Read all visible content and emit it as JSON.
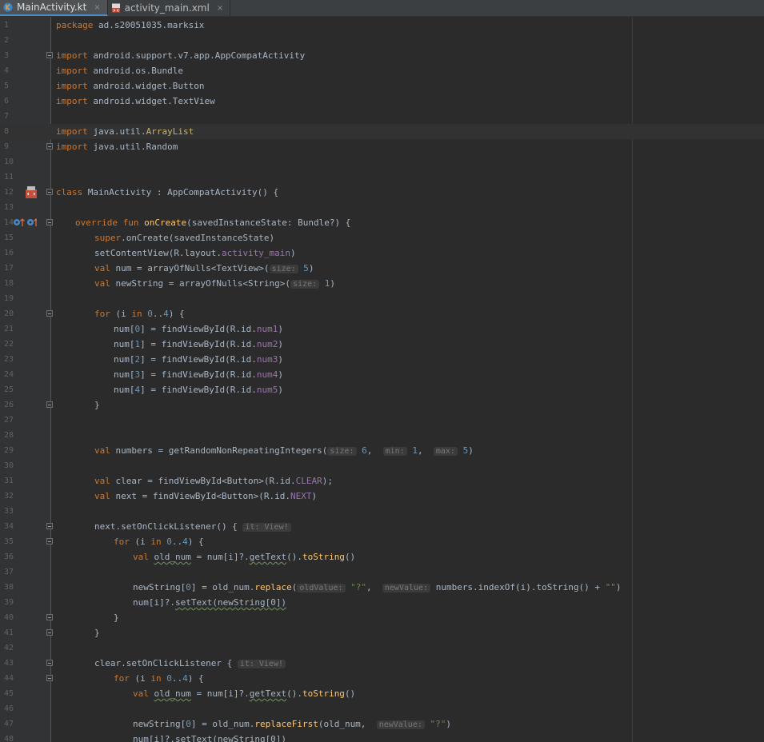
{
  "tabs": [
    {
      "label": "MainActivity.kt",
      "icon": "kotlin-file-icon",
      "active": true
    },
    {
      "label": "activity_main.xml",
      "icon": "xml-file-icon",
      "active": false
    }
  ],
  "tab_close_glyph": "×",
  "current_line": 8,
  "lines": [
    {
      "n": "1",
      "indent": 0,
      "tokens": [
        {
          "t": "package",
          "c": "kw"
        },
        {
          "t": " ad.s20051035.marksix"
        }
      ]
    },
    {
      "n": "2",
      "indent": 0,
      "tokens": []
    },
    {
      "n": "3",
      "indent": 0,
      "fold": true,
      "tokens": [
        {
          "t": "import",
          "c": "kw"
        },
        {
          "t": " android.support.v7.app.AppCompatActivity"
        }
      ]
    },
    {
      "n": "4",
      "indent": 0,
      "tokens": [
        {
          "t": "import",
          "c": "kw"
        },
        {
          "t": " android.os.Bundle"
        }
      ]
    },
    {
      "n": "5",
      "indent": 0,
      "tokens": [
        {
          "t": "import",
          "c": "kw"
        },
        {
          "t": " android.widget.Button"
        }
      ]
    },
    {
      "n": "6",
      "indent": 0,
      "tokens": [
        {
          "t": "import",
          "c": "kw"
        },
        {
          "t": " android.widget.TextView"
        }
      ]
    },
    {
      "n": "7",
      "indent": 0,
      "tokens": []
    },
    {
      "n": "8",
      "indent": 0,
      "tokens": [
        {
          "t": "import",
          "c": "kw"
        },
        {
          "t": " java.util."
        },
        {
          "t": "ArrayList",
          "c": "typ"
        }
      ]
    },
    {
      "n": "9",
      "indent": 0,
      "fold": true,
      "tokens": [
        {
          "t": "import",
          "c": "kw"
        },
        {
          "t": " java.util.Random"
        }
      ]
    },
    {
      "n": "10",
      "indent": 0,
      "tokens": []
    },
    {
      "n": "11",
      "indent": 0,
      "tokens": []
    },
    {
      "n": "12",
      "indent": 0,
      "fold": true,
      "gutter_icon": "android-layout-icon",
      "tokens": [
        {
          "t": "class",
          "c": "kw"
        },
        {
          "t": " MainActivity : AppCompatActivity() {"
        }
      ]
    },
    {
      "n": "13",
      "indent": 0,
      "tokens": []
    },
    {
      "n": "14",
      "indent": 1,
      "fold": true,
      "gutter_icon": "override-method-icon",
      "tokens": [
        {
          "t": "override fun ",
          "c": "kw"
        },
        {
          "t": "onCreate",
          "c": "fn"
        },
        {
          "t": "(savedInstanceState: Bundle?) {"
        }
      ]
    },
    {
      "n": "15",
      "indent": 2,
      "tokens": [
        {
          "t": "super",
          "c": "kw"
        },
        {
          "t": ".onCreate(savedInstanceState)"
        }
      ]
    },
    {
      "n": "16",
      "indent": 2,
      "tokens": [
        {
          "t": "setContentView(R.layout."
        },
        {
          "t": "activity_main",
          "c": "res"
        },
        {
          "t": ")"
        }
      ]
    },
    {
      "n": "17",
      "indent": 2,
      "tokens": [
        {
          "t": "val",
          "c": "kw"
        },
        {
          "t": " num = arrayOfNulls<TextView>("
        },
        {
          "t": "size:",
          "c": "hint"
        },
        {
          "t": " "
        },
        {
          "t": "5",
          "c": "num"
        },
        {
          "t": ")"
        }
      ]
    },
    {
      "n": "18",
      "indent": 2,
      "tokens": [
        {
          "t": "val",
          "c": "kw"
        },
        {
          "t": " newString = arrayOfNulls<String>("
        },
        {
          "t": "size:",
          "c": "hint"
        },
        {
          "t": " "
        },
        {
          "t": "1",
          "c": "num"
        },
        {
          "t": ")"
        }
      ]
    },
    {
      "n": "19",
      "indent": 0,
      "tokens": []
    },
    {
      "n": "20",
      "indent": 2,
      "fold": true,
      "tokens": [
        {
          "t": "for",
          "c": "kw"
        },
        {
          "t": " (i "
        },
        {
          "t": "in",
          "c": "kw"
        },
        {
          "t": " "
        },
        {
          "t": "0",
          "c": "num"
        },
        {
          "t": ".."
        },
        {
          "t": "4",
          "c": "num"
        },
        {
          "t": ") {"
        }
      ]
    },
    {
      "n": "21",
      "indent": 3,
      "tokens": [
        {
          "t": "num["
        },
        {
          "t": "0",
          "c": "num"
        },
        {
          "t": "] = findViewById(R.id."
        },
        {
          "t": "num1",
          "c": "res"
        },
        {
          "t": ")"
        }
      ]
    },
    {
      "n": "22",
      "indent": 3,
      "tokens": [
        {
          "t": "num["
        },
        {
          "t": "1",
          "c": "num"
        },
        {
          "t": "] = findViewById(R.id."
        },
        {
          "t": "num2",
          "c": "res"
        },
        {
          "t": ")"
        }
      ]
    },
    {
      "n": "23",
      "indent": 3,
      "tokens": [
        {
          "t": "num["
        },
        {
          "t": "2",
          "c": "num"
        },
        {
          "t": "] = findViewById(R.id."
        },
        {
          "t": "num3",
          "c": "res"
        },
        {
          "t": ")"
        }
      ]
    },
    {
      "n": "24",
      "indent": 3,
      "tokens": [
        {
          "t": "num["
        },
        {
          "t": "3",
          "c": "num"
        },
        {
          "t": "] = findViewById(R.id."
        },
        {
          "t": "num4",
          "c": "res"
        },
        {
          "t": ")"
        }
      ]
    },
    {
      "n": "25",
      "indent": 3,
      "tokens": [
        {
          "t": "num["
        },
        {
          "t": "4",
          "c": "num"
        },
        {
          "t": "] = findViewById(R.id."
        },
        {
          "t": "num5",
          "c": "res"
        },
        {
          "t": ")"
        }
      ]
    },
    {
      "n": "26",
      "indent": 2,
      "fold": true,
      "tokens": [
        {
          "t": "}"
        }
      ]
    },
    {
      "n": "27",
      "indent": 0,
      "tokens": []
    },
    {
      "n": "28",
      "indent": 0,
      "tokens": []
    },
    {
      "n": "29",
      "indent": 2,
      "tokens": [
        {
          "t": "val",
          "c": "kw"
        },
        {
          "t": " numbers = getRandomNonRepeatingIntegers("
        },
        {
          "t": "size:",
          "c": "hint"
        },
        {
          "t": " "
        },
        {
          "t": "6",
          "c": "num"
        },
        {
          "t": ",  "
        },
        {
          "t": "min:",
          "c": "hint"
        },
        {
          "t": " "
        },
        {
          "t": "1",
          "c": "num"
        },
        {
          "t": ",  "
        },
        {
          "t": "max:",
          "c": "hint"
        },
        {
          "t": " "
        },
        {
          "t": "5",
          "c": "num"
        },
        {
          "t": ")"
        }
      ]
    },
    {
      "n": "30",
      "indent": 0,
      "tokens": []
    },
    {
      "n": "31",
      "indent": 2,
      "tokens": [
        {
          "t": "val",
          "c": "kw"
        },
        {
          "t": " clear = findViewById<Button>(R.id."
        },
        {
          "t": "CLEAR",
          "c": "res"
        },
        {
          "t": ");"
        }
      ]
    },
    {
      "n": "32",
      "indent": 2,
      "tokens": [
        {
          "t": "val",
          "c": "kw"
        },
        {
          "t": " next = findViewById<Button>(R.id."
        },
        {
          "t": "NEXT",
          "c": "res"
        },
        {
          "t": ")"
        }
      ]
    },
    {
      "n": "33",
      "indent": 0,
      "tokens": []
    },
    {
      "n": "34",
      "indent": 2,
      "fold": true,
      "tokens": [
        {
          "t": "next.setOnClickListener() { "
        },
        {
          "t": "it: View!",
          "c": "hint"
        }
      ]
    },
    {
      "n": "35",
      "indent": 3,
      "fold": true,
      "tokens": [
        {
          "t": "for",
          "c": "kw"
        },
        {
          "t": " (i "
        },
        {
          "t": "in",
          "c": "kw"
        },
        {
          "t": " "
        },
        {
          "t": "0",
          "c": "num"
        },
        {
          "t": ".."
        },
        {
          "t": "4",
          "c": "num"
        },
        {
          "t": ") {"
        }
      ]
    },
    {
      "n": "36",
      "indent": 4,
      "tokens": [
        {
          "t": "val",
          "c": "kw"
        },
        {
          "t": " "
        },
        {
          "t": "old_num",
          "c": "wavy"
        },
        {
          "t": " = num[i]?."
        },
        {
          "t": "getText",
          "c": "wavy"
        },
        {
          "t": "()."
        },
        {
          "t": "toString",
          "c": "fn"
        },
        {
          "t": "()"
        }
      ]
    },
    {
      "n": "37",
      "indent": 0,
      "tokens": []
    },
    {
      "n": "38",
      "indent": 4,
      "tokens": [
        {
          "t": "newString["
        },
        {
          "t": "0",
          "c": "num"
        },
        {
          "t": "] = old_num."
        },
        {
          "t": "replace",
          "c": "fn"
        },
        {
          "t": "("
        },
        {
          "t": "oldValue:",
          "c": "hint"
        },
        {
          "t": " "
        },
        {
          "t": "\"?\"",
          "c": "str"
        },
        {
          "t": ",  "
        },
        {
          "t": "newValue:",
          "c": "hint"
        },
        {
          "t": " numbers.indexOf(i).toString() + "
        },
        {
          "t": "\"\"",
          "c": "str"
        },
        {
          "t": ")"
        }
      ]
    },
    {
      "n": "39",
      "indent": 4,
      "tokens": [
        {
          "t": "num[i]?."
        },
        {
          "t": "setText(newString[0])",
          "c": "wavy"
        }
      ]
    },
    {
      "n": "40",
      "indent": 3,
      "fold": true,
      "tokens": [
        {
          "t": "}"
        }
      ]
    },
    {
      "n": "41",
      "indent": 2,
      "fold": true,
      "tokens": [
        {
          "t": "}"
        }
      ]
    },
    {
      "n": "42",
      "indent": 0,
      "tokens": []
    },
    {
      "n": "43",
      "indent": 2,
      "fold": true,
      "tokens": [
        {
          "t": "clear.setOnClickListener { "
        },
        {
          "t": "it: View!",
          "c": "hint"
        }
      ]
    },
    {
      "n": "44",
      "indent": 3,
      "fold": true,
      "tokens": [
        {
          "t": "for",
          "c": "kw"
        },
        {
          "t": " (i "
        },
        {
          "t": "in",
          "c": "kw"
        },
        {
          "t": " "
        },
        {
          "t": "0",
          "c": "num"
        },
        {
          "t": ".."
        },
        {
          "t": "4",
          "c": "num"
        },
        {
          "t": ") {"
        }
      ]
    },
    {
      "n": "45",
      "indent": 4,
      "tokens": [
        {
          "t": "val",
          "c": "kw"
        },
        {
          "t": " "
        },
        {
          "t": "old_num",
          "c": "wavy"
        },
        {
          "t": " = num[i]?."
        },
        {
          "t": "getText",
          "c": "wavy"
        },
        {
          "t": "()."
        },
        {
          "t": "toString",
          "c": "fn"
        },
        {
          "t": "()"
        }
      ]
    },
    {
      "n": "46",
      "indent": 0,
      "tokens": []
    },
    {
      "n": "47",
      "indent": 4,
      "tokens": [
        {
          "t": "newString["
        },
        {
          "t": "0",
          "c": "num"
        },
        {
          "t": "] = old_num."
        },
        {
          "t": "replaceFirst",
          "c": "fn"
        },
        {
          "t": "(old_num,  "
        },
        {
          "t": "newValue:",
          "c": "hint"
        },
        {
          "t": " "
        },
        {
          "t": "\"?\"",
          "c": "str"
        },
        {
          "t": ")"
        }
      ]
    },
    {
      "n": "48",
      "indent": 4,
      "tokens": [
        {
          "t": "num[i]?.setText(newString[0])"
        }
      ]
    }
  ]
}
